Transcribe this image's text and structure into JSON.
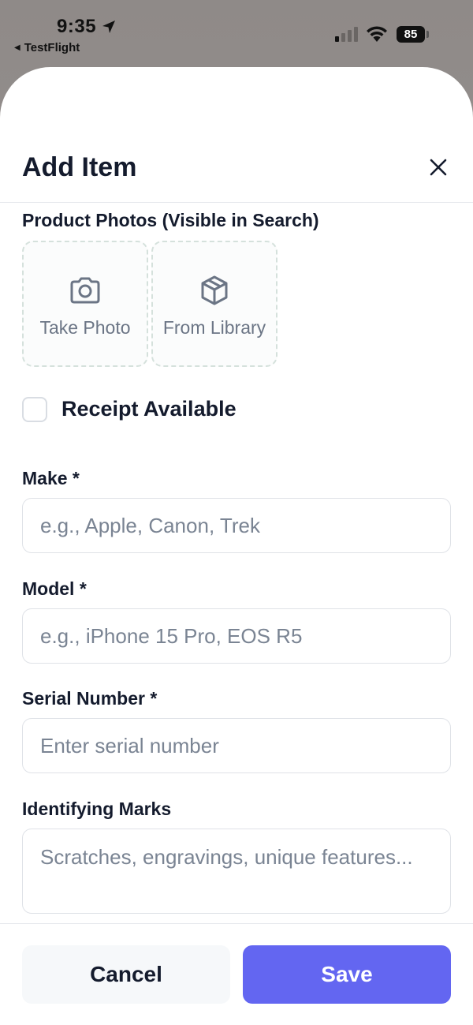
{
  "status_bar": {
    "time": "9:35",
    "back_app": "TestFlight",
    "battery": "85"
  },
  "sheet": {
    "title": "Add Item"
  },
  "photos": {
    "section_label": "Product Photos (Visible in Search)",
    "take_photo": "Take Photo",
    "from_library": "From Library"
  },
  "receipt": {
    "label": "Receipt Available",
    "checked": false
  },
  "fields": {
    "make": {
      "label": "Make *",
      "placeholder": "e.g., Apple, Canon, Trek",
      "value": ""
    },
    "model": {
      "label": "Model *",
      "placeholder": "e.g., iPhone 15 Pro, EOS R5",
      "value": ""
    },
    "serial": {
      "label": "Serial Number *",
      "placeholder": "Enter serial number",
      "value": ""
    },
    "marks": {
      "label": "Identifying Marks",
      "placeholder": "Scratches, engravings, unique features...",
      "value": ""
    }
  },
  "actions": {
    "cancel": "Cancel",
    "save": "Save"
  },
  "colors": {
    "accent": "#6366f1",
    "text": "#141b2d",
    "placeholder": "#7a8493"
  }
}
